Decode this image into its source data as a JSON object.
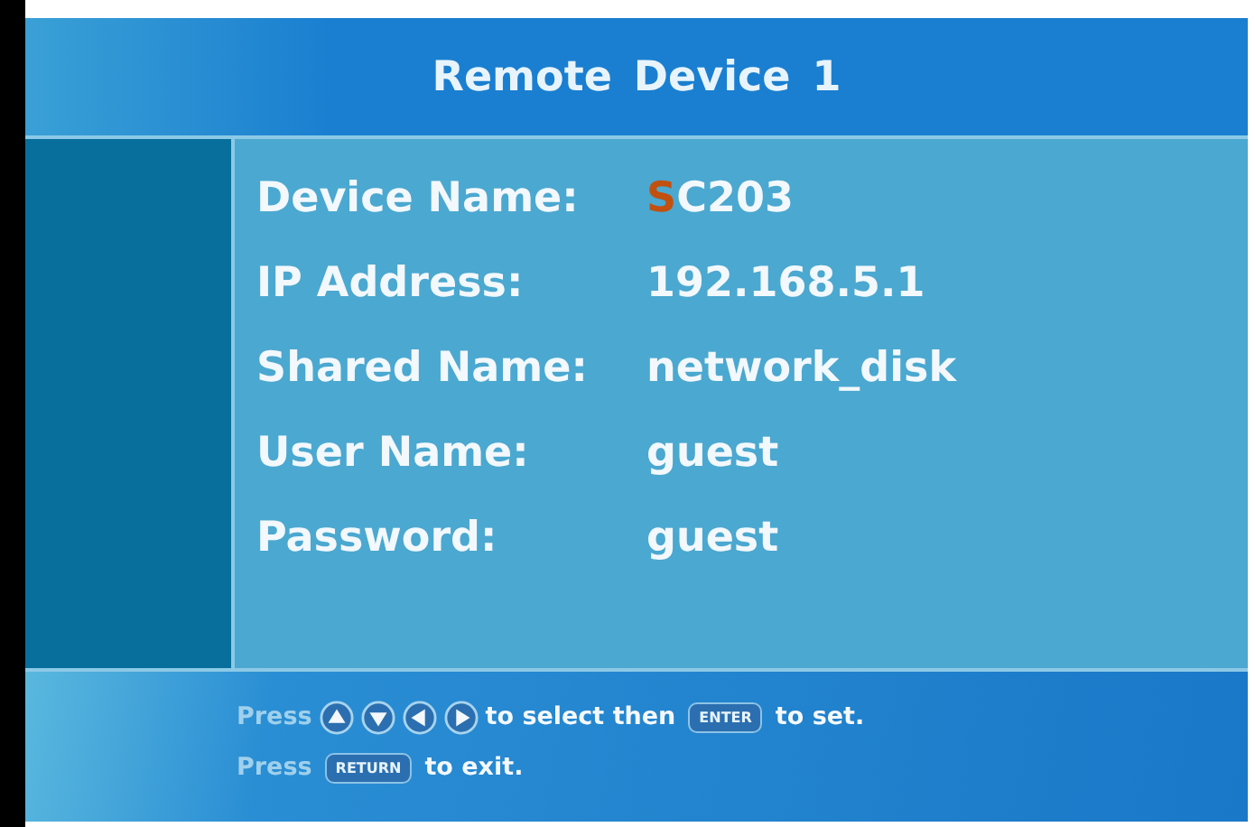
{
  "title": "Remote Device 1",
  "fields": [
    {
      "label": "Device Name:",
      "value_parts": [
        {
          "text": "S",
          "cursor": true
        },
        {
          "text": "C203",
          "cursor": false
        }
      ]
    },
    {
      "label": "IP Address:",
      "value_parts": [
        {
          "text": "192.168.5.1",
          "cursor": false
        }
      ]
    },
    {
      "label": "Shared Name:",
      "value_parts": [
        {
          "text": "network_disk",
          "cursor": false
        }
      ]
    },
    {
      "label": "User Name:",
      "value_parts": [
        {
          "text": "guest",
          "cursor": false
        }
      ]
    },
    {
      "label": "Password:",
      "value_parts": [
        {
          "text": "guest",
          "cursor": false
        }
      ]
    }
  ],
  "hints": [
    [
      {
        "kind": "dim",
        "text": "Press"
      },
      {
        "kind": "arrow_up"
      },
      {
        "kind": "arrow_down"
      },
      {
        "kind": "arrow_left"
      },
      {
        "kind": "arrow_right"
      },
      {
        "kind": "text",
        "text": "to select then"
      },
      {
        "kind": "key",
        "text": "ENTER"
      },
      {
        "kind": "text",
        "text": "to set."
      }
    ],
    [
      {
        "kind": "dim",
        "text": "Press"
      },
      {
        "kind": "key",
        "text": "RETURN"
      },
      {
        "kind": "text",
        "text": "to exit."
      }
    ]
  ]
}
